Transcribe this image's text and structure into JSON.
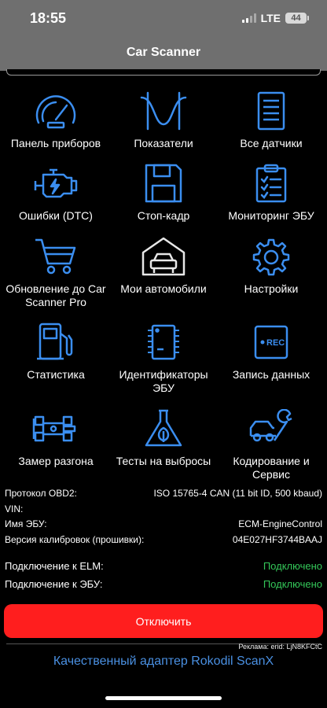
{
  "status": {
    "time": "18:55",
    "network": "LTE",
    "battery": "44"
  },
  "nav": {
    "title": "Car Scanner"
  },
  "accent": "#3b8ef0",
  "tiles": [
    {
      "label": "Панель приборов",
      "icon": "dashboard-gauge-icon"
    },
    {
      "label": "Показатели",
      "icon": "sine-wave-icon"
    },
    {
      "label": "Все датчики",
      "icon": "checklist-icon"
    },
    {
      "label": "Ошибки (DTC)",
      "icon": "engine-icon"
    },
    {
      "label": "Стоп-кадр",
      "icon": "floppy-disk-icon"
    },
    {
      "label": "Мониторинг ЭБУ",
      "icon": "clipboard-check-icon"
    },
    {
      "label": "Обновление до Car Scanner Pro",
      "icon": "shopping-cart-icon"
    },
    {
      "label": "Мои автомобили",
      "icon": "garage-car-icon"
    },
    {
      "label": "Настройки",
      "icon": "gear-icon"
    },
    {
      "label": "Статистика",
      "icon": "fuel-pump-icon"
    },
    {
      "label": "Идентификаторы ЭБУ",
      "icon": "chip-icon"
    },
    {
      "label": "Запись данных",
      "icon": "record-icon",
      "badge": "REC"
    },
    {
      "label": "Замер разгона",
      "icon": "race-car-icon"
    },
    {
      "label": "Тесты на выбросы",
      "icon": "flask-leaf-icon"
    },
    {
      "label": "Кодирование и Сервис",
      "icon": "car-wrench-icon"
    }
  ],
  "info": [
    {
      "label": "Протокол OBD2:",
      "value": "ISO 15765-4 CAN (11 bit ID, 500 kbaud)"
    },
    {
      "label": "VIN:",
      "value": ""
    },
    {
      "label": "Имя ЭБУ:",
      "value": "ECM-EngineControl"
    },
    {
      "label": "Версия калибровок (прошивки):",
      "value": "04E027HF3744BAAJ"
    }
  ],
  "connection": [
    {
      "label": "Подключение к ELM:",
      "value": "Подключено"
    },
    {
      "label": "Подключение к ЭБУ:",
      "value": "Подключено"
    }
  ],
  "disconnect_label": "Отключить",
  "ad": {
    "tag": "Реклама: erid: LjN8KFCtC",
    "link": "Качественный адаптер Rokodil ScanX"
  }
}
